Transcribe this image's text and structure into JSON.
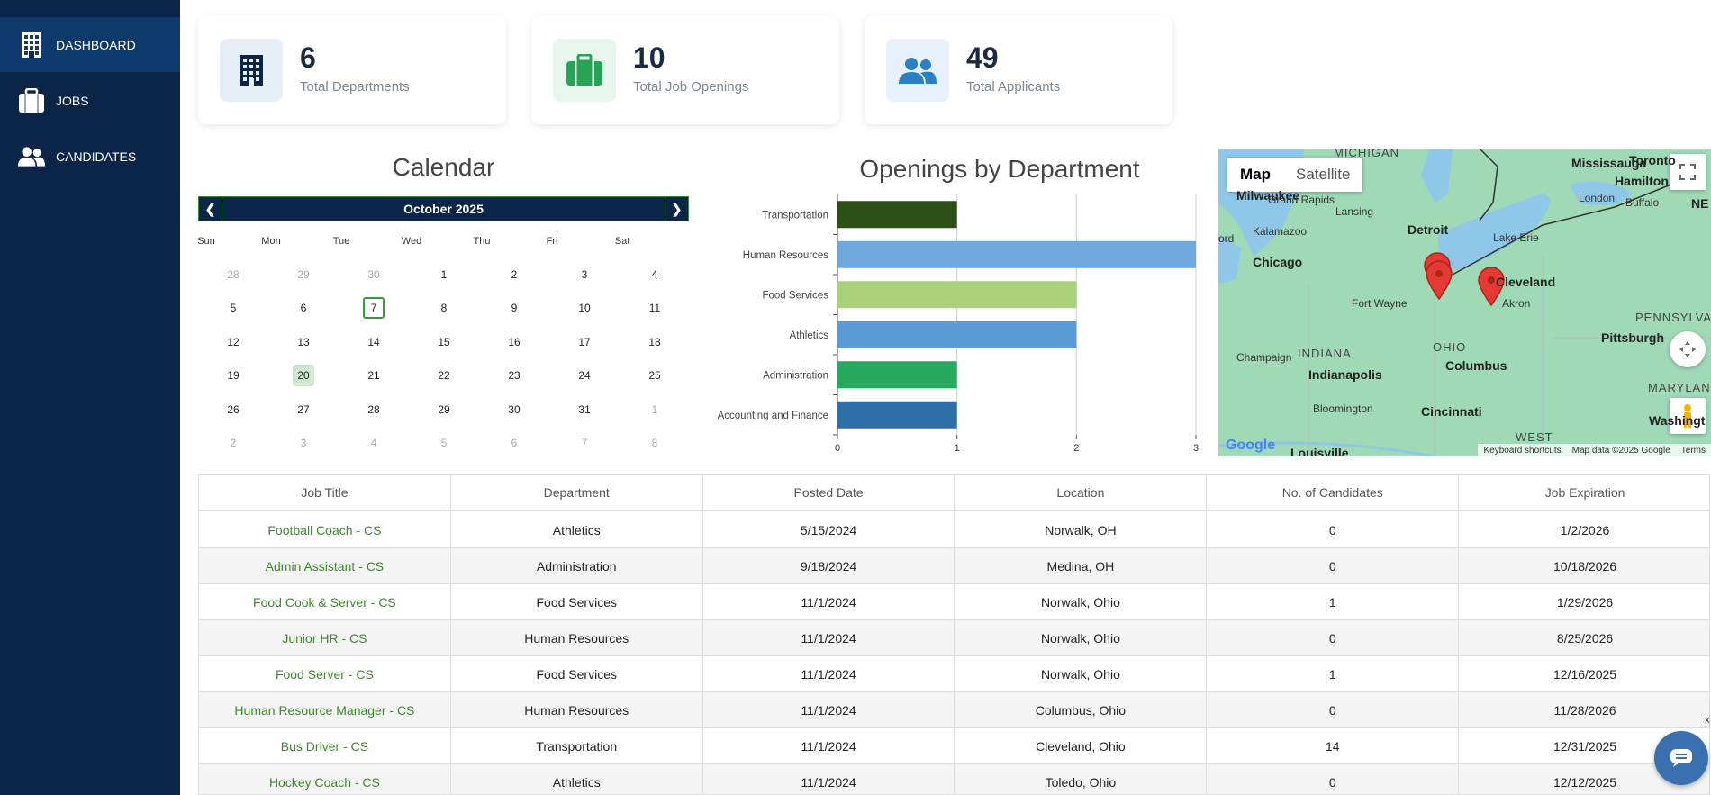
{
  "sidebar": {
    "items": [
      {
        "label": "DASHBOARD",
        "icon": "building-icon",
        "active": true
      },
      {
        "label": "JOBS",
        "icon": "briefcase-icon",
        "active": false
      },
      {
        "label": "CANDIDATES",
        "icon": "users-icon",
        "active": false
      }
    ]
  },
  "stats": [
    {
      "value": "6",
      "label": "Total Departments",
      "icon": "building-icon",
      "color": "#0a2547",
      "bg": "#e6eef8"
    },
    {
      "value": "10",
      "label": "Total Job Openings",
      "icon": "briefcase-icon",
      "color": "#27a356",
      "bg": "#e6f6ec"
    },
    {
      "value": "49",
      "label": "Total Applicants",
      "icon": "users-icon",
      "color": "#2d7fc4",
      "bg": "#e6f1fb"
    }
  ],
  "calendar": {
    "title": "Calendar",
    "month_label": "October 2025",
    "prev_icon": "chevron-left-icon",
    "next_icon": "chevron-right-icon",
    "weekdays": [
      "Sun",
      "Mon",
      "Tue",
      "Wed",
      "Thu",
      "Fri",
      "Sat"
    ],
    "weeks": [
      [
        "28",
        "29",
        "30",
        "1",
        "2",
        "3",
        "4"
      ],
      [
        "5",
        "6",
        "7",
        "8",
        "9",
        "10",
        "11"
      ],
      [
        "12",
        "13",
        "14",
        "15",
        "16",
        "17",
        "18"
      ],
      [
        "19",
        "20",
        "21",
        "22",
        "23",
        "24",
        "25"
      ],
      [
        "26",
        "27",
        "28",
        "29",
        "30",
        "31",
        "1"
      ],
      [
        "2",
        "3",
        "4",
        "5",
        "6",
        "7",
        "8"
      ]
    ],
    "today": "7",
    "selected": "20"
  },
  "chart_data": {
    "type": "bar",
    "orientation": "horizontal",
    "title": "Openings by Department",
    "categories": [
      "Transportation",
      "Human Resources",
      "Food Services",
      "Athletics",
      "Administration",
      "Accounting and Finance"
    ],
    "values": [
      1,
      3,
      2,
      2,
      1,
      1
    ],
    "colors": [
      "#2d5016",
      "#6fa8dc",
      "#a8d17a",
      "#5b9bd5",
      "#27a85f",
      "#2e6fa8"
    ],
    "xlim": [
      0,
      3
    ],
    "xticks": [
      "0",
      "1",
      "2",
      "3"
    ],
    "grid": true
  },
  "map": {
    "tabs": [
      "Map",
      "Satellite"
    ],
    "active_tab": "Map",
    "labels": [
      "MICHIGAN",
      "Mississauga",
      "Toronto",
      "Hamilton",
      "Buffalo",
      "London",
      "Milwaukee",
      "Grand Rapids",
      "Lansing",
      "Kalamazoo",
      "Detroit",
      "Chicago",
      "Lake Erie",
      "Cleveland",
      "Akron",
      "Fort Wayne",
      "PENNSYLVANIA",
      "Pittsburgh",
      "Champaign",
      "INDIANA",
      "OHIO",
      "Columbus",
      "Indianapolis",
      "MARYLAN",
      "Bloomington",
      "Cincinnati",
      "Washingt",
      "WEST",
      "Louisville",
      "ord",
      "NE"
    ],
    "footer": [
      "Keyboard shortcuts",
      "Map data ©2025 Google",
      "Terms"
    ],
    "logo": "Google"
  },
  "table": {
    "headers": [
      "Job Title",
      "Department",
      "Posted Date",
      "Location",
      "No. of Candidates",
      "Job Expiration"
    ],
    "rows": [
      [
        "Football Coach - CS",
        "Athletics",
        "5/15/2024",
        "Norwalk, OH",
        "0",
        "1/2/2026"
      ],
      [
        "Admin Assistant - CS",
        "Administration",
        "9/18/2024",
        "Medina, OH",
        "0",
        "10/18/2026"
      ],
      [
        "Food Cook & Server - CS",
        "Food Services",
        "11/1/2024",
        "Norwalk, Ohio",
        "1",
        "1/29/2026"
      ],
      [
        "Junior HR - CS",
        "Human Resources",
        "11/1/2024",
        "Norwalk, Ohio",
        "0",
        "8/25/2026"
      ],
      [
        "Food Server - CS",
        "Food Services",
        "11/1/2024",
        "Norwalk, Ohio",
        "1",
        "12/16/2025"
      ],
      [
        "Human Resource Manager - CS",
        "Human Resources",
        "11/1/2024",
        "Columbus, Ohio",
        "0",
        "11/28/2026"
      ],
      [
        "Bus Driver - CS",
        "Transportation",
        "11/1/2024",
        "Cleveland, Ohio",
        "14",
        "12/31/2025"
      ],
      [
        "Hockey Coach - CS",
        "Athletics",
        "11/1/2024",
        "Toledo, Ohio",
        "0",
        "12/12/2025"
      ]
    ]
  },
  "chat_icon": "chat-bubble-icon",
  "scroll_marker": "x"
}
